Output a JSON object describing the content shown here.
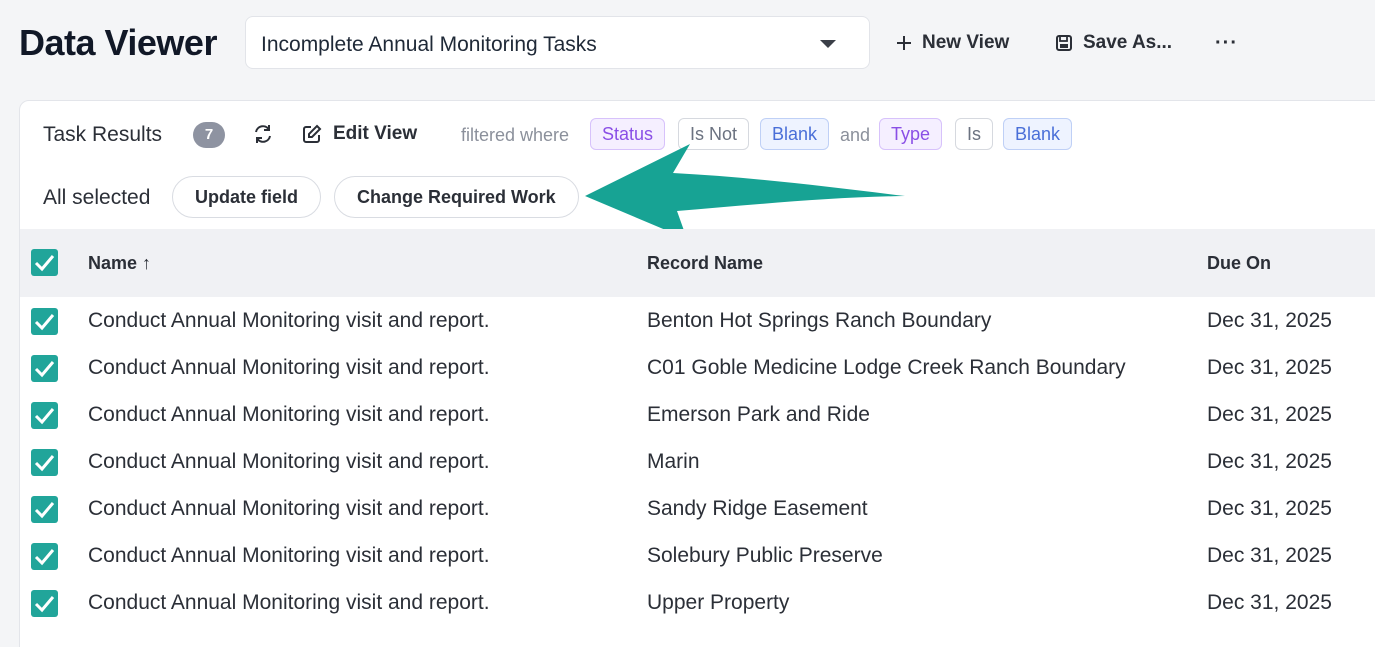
{
  "header": {
    "title": "Data Viewer",
    "view_selected": "Incomplete Annual Monitoring Tasks",
    "new_view_label": "New View",
    "save_as_label": "Save As...",
    "more_label": "···"
  },
  "toolbar": {
    "results_label": "Task Results",
    "count": "7",
    "edit_view_label": "Edit View",
    "filtered_label": "filtered where",
    "and_label": "and",
    "filters": [
      "Status",
      "Is Not",
      "Blank",
      "Type",
      "Is",
      "Blank"
    ]
  },
  "selection": {
    "label": "All selected",
    "update_field_label": "Update field",
    "change_work_label": "Change Required Work"
  },
  "table": {
    "columns": [
      "Name ↑",
      "Record Name",
      "Due On"
    ],
    "rows": [
      {
        "name": "Conduct Annual Monitoring visit and report.",
        "record": "Benton Hot Springs Ranch Boundary",
        "due": "Dec 31, 2025"
      },
      {
        "name": "Conduct Annual Monitoring visit and report.",
        "record": "C01 Goble Medicine Lodge Creek Ranch Boundary",
        "due": "Dec 31, 2025"
      },
      {
        "name": "Conduct Annual Monitoring visit and report.",
        "record": "Emerson Park and Ride",
        "due": "Dec 31, 2025"
      },
      {
        "name": "Conduct Annual Monitoring visit and report.",
        "record": "Marin",
        "due": "Dec 31, 2025"
      },
      {
        "name": "Conduct Annual Monitoring visit and report.",
        "record": "Sandy Ridge Easement",
        "due": "Dec 31, 2025"
      },
      {
        "name": "Conduct Annual Monitoring visit and report.",
        "record": "Solebury Public Preserve",
        "due": "Dec 31, 2025"
      },
      {
        "name": "Conduct Annual Monitoring visit and report.",
        "record": "Upper Property",
        "due": "Dec 31, 2025"
      }
    ]
  },
  "colors": {
    "accent": "#21a59a",
    "annotation_arrow": "#17a394"
  },
  "icons": [
    "plus-icon",
    "save-icon",
    "refresh-icon",
    "edit-icon",
    "check-icon",
    "chevron-down-icon"
  ]
}
